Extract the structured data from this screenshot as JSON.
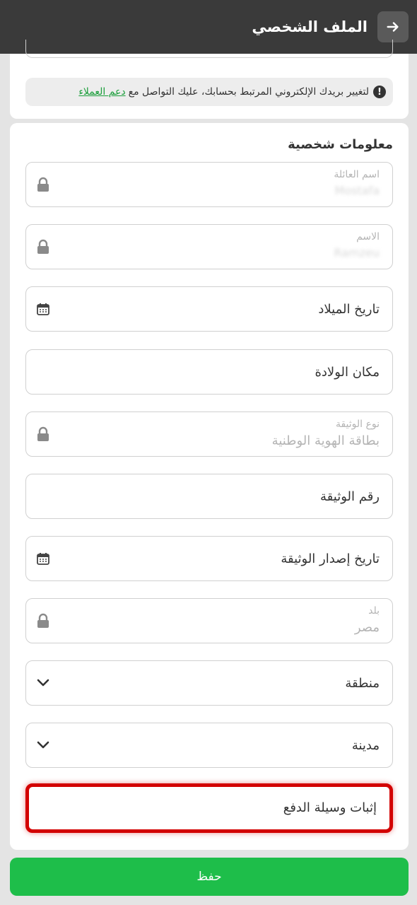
{
  "header": {
    "title": "الملف الشخصي"
  },
  "notice": {
    "text": "لتغيير بريدك الإلكتروني المرتبط بحسابك، عليك التواصل مع",
    "link": "دعم العملاء"
  },
  "section": {
    "title": "معلومات شخصية"
  },
  "fields": {
    "last_name": {
      "label": "اسم العائلة",
      "value": "Mostafa"
    },
    "first_name": {
      "label": "الاسم",
      "value": "Ramzeu"
    },
    "birth_date": {
      "label": "تاريخ الميلاد"
    },
    "birth_place": {
      "label": "مكان الولادة"
    },
    "doc_type": {
      "label": "نوع الوثيقة",
      "value": "بطاقة الهوية الوطنية"
    },
    "doc_number": {
      "label": "رقم الوثيقة"
    },
    "doc_issue_date": {
      "label": "تاريخ إصدار الوثيقة"
    },
    "country": {
      "label": "بلد",
      "value": "مصر"
    },
    "region": {
      "label": "منطقة"
    },
    "city": {
      "label": "مدينة"
    },
    "payment_proof": {
      "label": "إثبات وسيلة الدفع"
    }
  },
  "save": {
    "label": "حفظ"
  },
  "colors": {
    "header": "#3a3a3a",
    "accent": "#1ebe4a",
    "link": "#1a9e3a",
    "highlight": "#d30000"
  }
}
